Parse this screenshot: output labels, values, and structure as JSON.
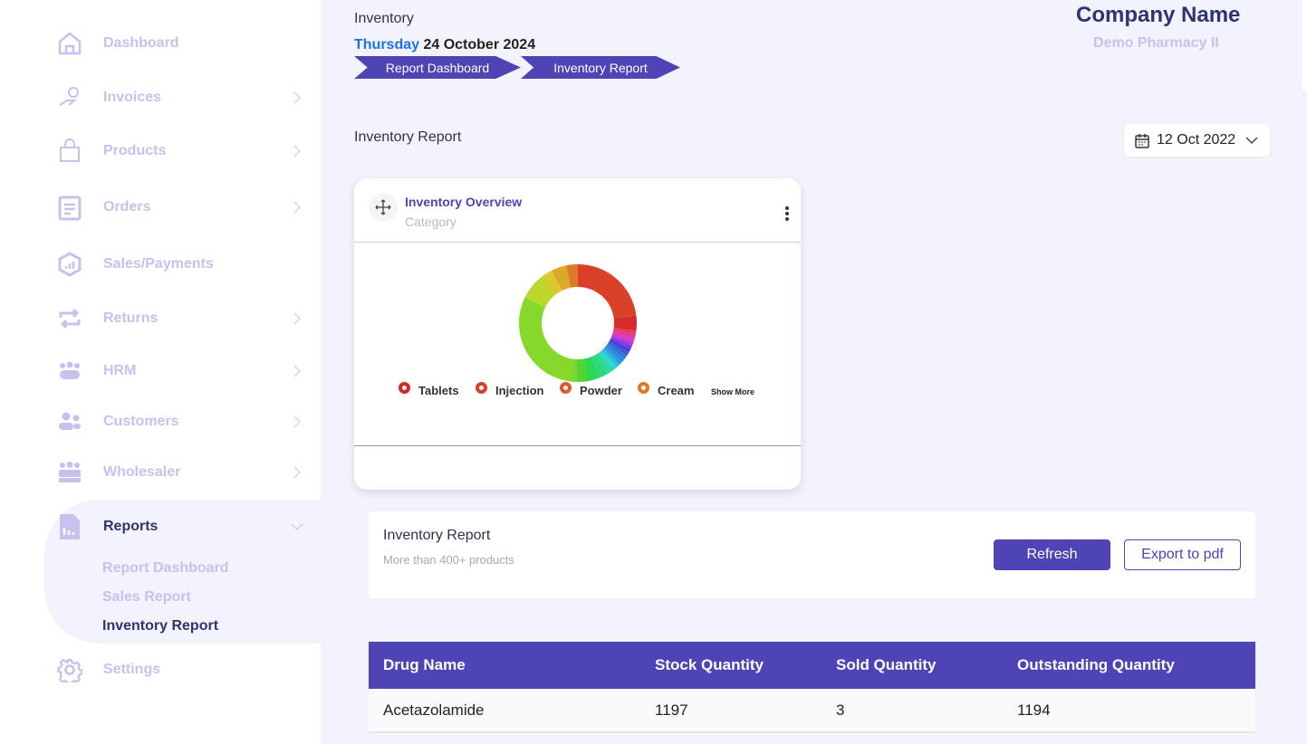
{
  "sidebar": {
    "items": [
      {
        "label": "Dashboard",
        "icon": "home-icon"
      },
      {
        "label": "Invoices",
        "icon": "hand-coin-icon"
      },
      {
        "label": "Products",
        "icon": "bag-icon"
      },
      {
        "label": "Orders",
        "icon": "clipboard-icon"
      },
      {
        "label": "Sales/Payments",
        "icon": "chart-hexagon-icon"
      },
      {
        "label": "Returns",
        "icon": "repeat-icon"
      },
      {
        "label": "HRM",
        "icon": "team-icon"
      },
      {
        "label": "Customers",
        "icon": "users-icon"
      },
      {
        "label": "Wholesaler",
        "icon": "group-icon"
      },
      {
        "label": "Reports",
        "icon": "report-icon"
      },
      {
        "label": "Settings",
        "icon": "gear-icon"
      }
    ],
    "sub_items": [
      "Report Dashboard",
      "Sales Report",
      "Inventory Report"
    ],
    "active_sub": "Inventory Report"
  },
  "header": {
    "section": "Inventory",
    "weekday": "Thursday",
    "date": "24 October 2024",
    "breadcrumb": [
      "Report Dashboard",
      "Inventory Report"
    ],
    "company": "Company Name",
    "pharmacy": "Demo Pharmacy II"
  },
  "page_title": "Inventory Report",
  "date_filter": "12 Oct 2022",
  "overview_card": {
    "title": "Inventory Overview",
    "subtitle": "Category",
    "show_more": "Show More"
  },
  "chart_data": {
    "type": "pie",
    "donut": true,
    "legend": [
      "Tablets",
      "Injection",
      "Powder",
      "Cream"
    ],
    "legend_colors": [
      "#d62828",
      "#d9402a",
      "#dc5a28",
      "#dc7a28"
    ],
    "values": [
      22,
      4,
      1,
      1,
      1,
      1,
      1,
      1,
      1,
      1,
      1,
      1,
      1,
      1,
      1,
      1,
      2,
      2,
      1,
      1,
      1,
      1,
      1,
      1,
      29,
      7,
      3,
      4,
      3
    ],
    "colors": [
      "#da4128",
      "#d92a2a",
      "#e83a5a",
      "#e23a8a",
      "#d83ac8",
      "#b03ae0",
      "#7a3ae0",
      "#4a3ad8",
      "#3a5ad8",
      "#2a7ad8",
      "#2a8ae0",
      "#2aa0e0",
      "#2ac0e0",
      "#2ad8d0",
      "#2ad8b0",
      "#2ad898",
      "#2ad880",
      "#2ad860",
      "#2ad840",
      "#3ad830",
      "#4ad830",
      "#5ad030",
      "#6ad830",
      "#78d830",
      "#86d92a",
      "#bcd72a",
      "#dcc82a",
      "#dca82a",
      "#dc7a2a"
    ]
  },
  "report_panel": {
    "title": "Inventory Report",
    "subtitle": "More than 400+ products",
    "refresh": "Refresh",
    "export": "Export to pdf"
  },
  "table": {
    "columns": [
      "Drug Name",
      "Stock Quantity",
      "Sold Quantity",
      "Outstanding Quantity"
    ],
    "rows": [
      [
        "Acetazolamide",
        "1197",
        "3",
        "1194"
      ]
    ]
  },
  "colors": {
    "primary": "#4f44b5",
    "sidebar_text": "#c7c1f0",
    "background": "#f3f3fd",
    "weekday": "#1a73e8",
    "company": "#2e3470"
  }
}
